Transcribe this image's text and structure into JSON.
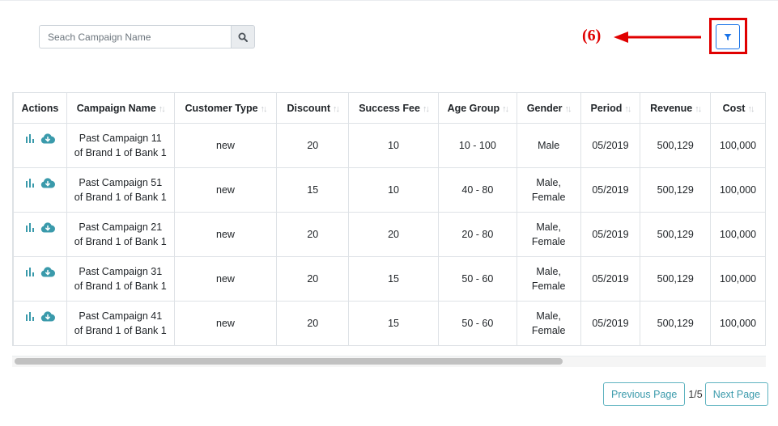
{
  "search": {
    "placeholder": "Seach Campaign Name"
  },
  "annotation": {
    "label": "(6)"
  },
  "table": {
    "headers": [
      "Actions",
      "Campaign Name",
      "Customer Type",
      "Discount",
      "Success Fee",
      "Age Group",
      "Gender",
      "Period",
      "Revenue",
      "Cost"
    ],
    "rows": [
      {
        "name_line1": "Past Campaign 11",
        "name_line2": "of Brand 1 of Bank 1",
        "customer_type": "new",
        "discount": "20",
        "success_fee": "10",
        "age_group": "10 - 100",
        "gender_line1": "Male",
        "gender_line2": "",
        "period": "05/2019",
        "revenue": "500,129",
        "cost": "100,000"
      },
      {
        "name_line1": "Past Campaign 51",
        "name_line2": "of Brand 1 of Bank 1",
        "customer_type": "new",
        "discount": "15",
        "success_fee": "10",
        "age_group": "40 - 80",
        "gender_line1": "Male,",
        "gender_line2": "Female",
        "period": "05/2019",
        "revenue": "500,129",
        "cost": "100,000"
      },
      {
        "name_line1": "Past Campaign 21",
        "name_line2": "of Brand 1 of Bank 1",
        "customer_type": "new",
        "discount": "20",
        "success_fee": "20",
        "age_group": "20 - 80",
        "gender_line1": "Male,",
        "gender_line2": "Female",
        "period": "05/2019",
        "revenue": "500,129",
        "cost": "100,000"
      },
      {
        "name_line1": "Past Campaign 31",
        "name_line2": "of Brand 1 of Bank 1",
        "customer_type": "new",
        "discount": "20",
        "success_fee": "15",
        "age_group": "50 - 60",
        "gender_line1": "Male,",
        "gender_line2": "Female",
        "period": "05/2019",
        "revenue": "500,129",
        "cost": "100,000"
      },
      {
        "name_line1": "Past Campaign 41",
        "name_line2": "of Brand 1 of Bank 1",
        "customer_type": "new",
        "discount": "20",
        "success_fee": "15",
        "age_group": "50 - 60",
        "gender_line1": "Male,",
        "gender_line2": "Female",
        "period": "05/2019",
        "revenue": "500,129",
        "cost": "100,000"
      }
    ]
  },
  "pagination": {
    "previous_label": "Previous Page",
    "page_count": "1/5",
    "next_label": "Next Page"
  },
  "colors": {
    "accent": "#3a9aab",
    "annotation": "#e00000",
    "filter_border": "#1a73e8"
  }
}
